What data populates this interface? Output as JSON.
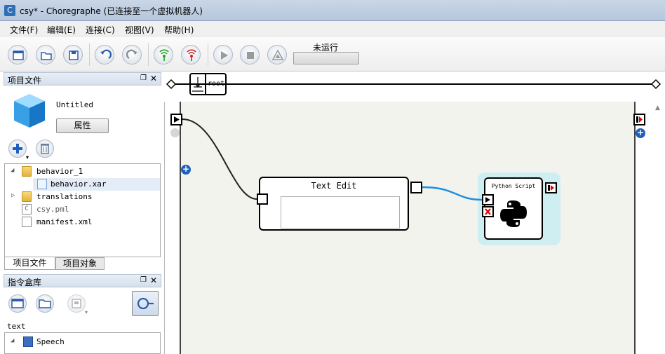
{
  "window": {
    "title": "csy* - Choregraphe (已连接至一个虚拟机器人)",
    "app_icon_letter": "C"
  },
  "menu": [
    "文件(F)",
    "编辑(E)",
    "连接(C)",
    "视图(V)",
    "帮助(H)"
  ],
  "toolbar": {
    "status_text": "未运行",
    "icons": [
      "new-project-icon",
      "open-project-icon",
      "save-project-icon",
      "undo-icon",
      "redo-icon",
      "connect-icon",
      "disconnect-icon",
      "play-icon",
      "stop-icon",
      "debug-icon"
    ],
    "progress": 0
  },
  "project_panel": {
    "title": "项目文件",
    "project_name": "Untitled",
    "properties_label": "属性",
    "tree": [
      {
        "label": "behavior_1",
        "type": "folder",
        "expanded": true,
        "level": 0
      },
      {
        "label": "behavior.xar",
        "type": "file",
        "selected": true,
        "level": 1
      },
      {
        "label": "translations",
        "type": "folder",
        "expanded": false,
        "level": 0
      },
      {
        "label": "csy.pml",
        "type": "project-file",
        "level": 0
      },
      {
        "label": "manifest.xml",
        "type": "file",
        "level": 0
      }
    ],
    "tabs": [
      "项目文件",
      "项目对象"
    ]
  },
  "box_library": {
    "title": "指令盒库",
    "filter_text": "text",
    "tree": [
      {
        "label": "Speech",
        "expanded": true
      }
    ]
  },
  "diagram": {
    "breadcrumb_label": "root",
    "boxes": [
      {
        "name": "Text Edit"
      },
      {
        "name": "Python Script",
        "selected": true
      }
    ]
  }
}
